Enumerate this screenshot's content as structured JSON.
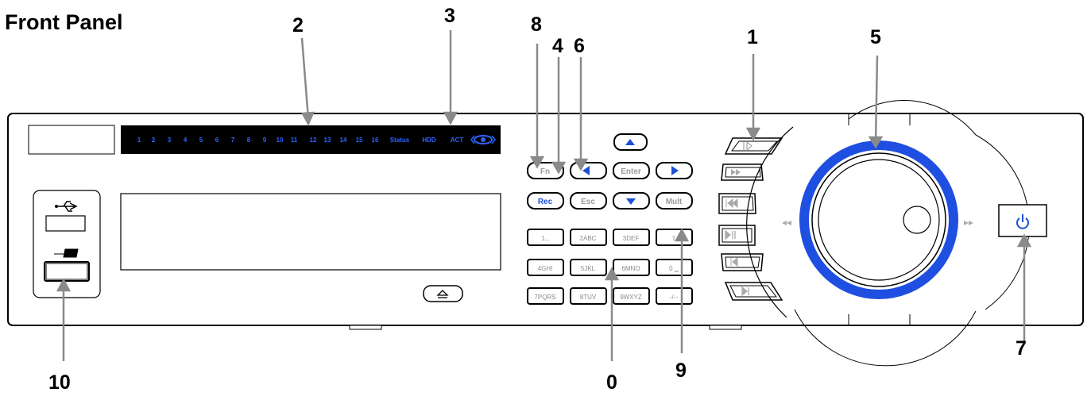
{
  "title": "Front Panel",
  "led_labels": [
    "1",
    "2",
    "3",
    "4",
    "5",
    "6",
    "7",
    "8",
    "9",
    "10",
    "11",
    "12",
    "13",
    "14",
    "15",
    "16",
    "Status",
    "HDD",
    "ACT"
  ],
  "buttons": {
    "fn": "Fn",
    "enter": "Enter",
    "rec": "Rec",
    "esc": "Esc",
    "mult": "Mult"
  },
  "keypad": [
    "1.,",
    "2ABC",
    "3DEF",
    "⇧",
    "4GHI",
    "5JKL",
    "6MNO",
    "0 ␣",
    "7PQRS",
    "8TUV",
    "9WXYZ",
    "-/--"
  ],
  "callouts": [
    "1",
    "2",
    "3",
    "4",
    "5",
    "6",
    "7",
    "8",
    "9",
    "10",
    "0"
  ],
  "colors": {
    "accent": "#2d63ff",
    "ring": "#1f4fe0",
    "panel": "#000000"
  }
}
